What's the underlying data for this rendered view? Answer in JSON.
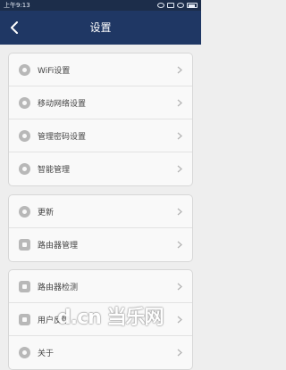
{
  "status_bar": {
    "time": "上午9:13"
  },
  "header": {
    "title": "设置"
  },
  "groups": [
    {
      "items": [
        {
          "icon": "wifi-icon",
          "label": "WiFi设置"
        },
        {
          "icon": "globe-icon",
          "label": "移动网络设置"
        },
        {
          "icon": "shield-icon",
          "label": "管理密码设置"
        },
        {
          "icon": "gear-icon",
          "label": "智能管理"
        }
      ]
    },
    {
      "items": [
        {
          "icon": "upload-icon",
          "label": "更新"
        },
        {
          "icon": "router-icon",
          "label": "路由器管理"
        }
      ]
    },
    {
      "items": [
        {
          "icon": "diagnose-icon",
          "label": "路由器检测"
        },
        {
          "icon": "feedback-icon",
          "label": "用户反馈"
        },
        {
          "icon": "info-icon",
          "label": "关于"
        }
      ]
    }
  ],
  "watermark": {
    "text": "d.cn 当乐网"
  },
  "colors": {
    "header_bg": "#1f3764",
    "status_bg": "#1c2d4a",
    "page_bg": "#eeeeee",
    "card_bg": "#f9f9f9"
  }
}
